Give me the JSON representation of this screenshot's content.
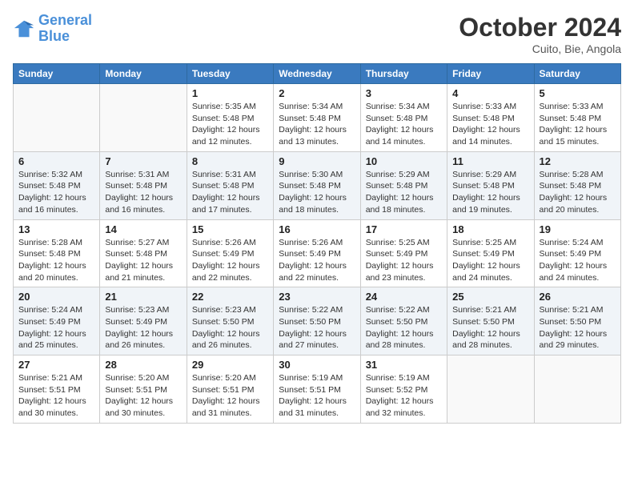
{
  "logo": {
    "line1": "General",
    "line2": "Blue"
  },
  "title": "October 2024",
  "location": "Cuito, Bie, Angola",
  "days_header": [
    "Sunday",
    "Monday",
    "Tuesday",
    "Wednesday",
    "Thursday",
    "Friday",
    "Saturday"
  ],
  "weeks": [
    [
      {
        "num": "",
        "info": ""
      },
      {
        "num": "",
        "info": ""
      },
      {
        "num": "1",
        "info": "Sunrise: 5:35 AM\nSunset: 5:48 PM\nDaylight: 12 hours\nand 12 minutes."
      },
      {
        "num": "2",
        "info": "Sunrise: 5:34 AM\nSunset: 5:48 PM\nDaylight: 12 hours\nand 13 minutes."
      },
      {
        "num": "3",
        "info": "Sunrise: 5:34 AM\nSunset: 5:48 PM\nDaylight: 12 hours\nand 14 minutes."
      },
      {
        "num": "4",
        "info": "Sunrise: 5:33 AM\nSunset: 5:48 PM\nDaylight: 12 hours\nand 14 minutes."
      },
      {
        "num": "5",
        "info": "Sunrise: 5:33 AM\nSunset: 5:48 PM\nDaylight: 12 hours\nand 15 minutes."
      }
    ],
    [
      {
        "num": "6",
        "info": "Sunrise: 5:32 AM\nSunset: 5:48 PM\nDaylight: 12 hours\nand 16 minutes."
      },
      {
        "num": "7",
        "info": "Sunrise: 5:31 AM\nSunset: 5:48 PM\nDaylight: 12 hours\nand 16 minutes."
      },
      {
        "num": "8",
        "info": "Sunrise: 5:31 AM\nSunset: 5:48 PM\nDaylight: 12 hours\nand 17 minutes."
      },
      {
        "num": "9",
        "info": "Sunrise: 5:30 AM\nSunset: 5:48 PM\nDaylight: 12 hours\nand 18 minutes."
      },
      {
        "num": "10",
        "info": "Sunrise: 5:29 AM\nSunset: 5:48 PM\nDaylight: 12 hours\nand 18 minutes."
      },
      {
        "num": "11",
        "info": "Sunrise: 5:29 AM\nSunset: 5:48 PM\nDaylight: 12 hours\nand 19 minutes."
      },
      {
        "num": "12",
        "info": "Sunrise: 5:28 AM\nSunset: 5:48 PM\nDaylight: 12 hours\nand 20 minutes."
      }
    ],
    [
      {
        "num": "13",
        "info": "Sunrise: 5:28 AM\nSunset: 5:48 PM\nDaylight: 12 hours\nand 20 minutes."
      },
      {
        "num": "14",
        "info": "Sunrise: 5:27 AM\nSunset: 5:48 PM\nDaylight: 12 hours\nand 21 minutes."
      },
      {
        "num": "15",
        "info": "Sunrise: 5:26 AM\nSunset: 5:49 PM\nDaylight: 12 hours\nand 22 minutes."
      },
      {
        "num": "16",
        "info": "Sunrise: 5:26 AM\nSunset: 5:49 PM\nDaylight: 12 hours\nand 22 minutes."
      },
      {
        "num": "17",
        "info": "Sunrise: 5:25 AM\nSunset: 5:49 PM\nDaylight: 12 hours\nand 23 minutes."
      },
      {
        "num": "18",
        "info": "Sunrise: 5:25 AM\nSunset: 5:49 PM\nDaylight: 12 hours\nand 24 minutes."
      },
      {
        "num": "19",
        "info": "Sunrise: 5:24 AM\nSunset: 5:49 PM\nDaylight: 12 hours\nand 24 minutes."
      }
    ],
    [
      {
        "num": "20",
        "info": "Sunrise: 5:24 AM\nSunset: 5:49 PM\nDaylight: 12 hours\nand 25 minutes."
      },
      {
        "num": "21",
        "info": "Sunrise: 5:23 AM\nSunset: 5:49 PM\nDaylight: 12 hours\nand 26 minutes."
      },
      {
        "num": "22",
        "info": "Sunrise: 5:23 AM\nSunset: 5:50 PM\nDaylight: 12 hours\nand 26 minutes."
      },
      {
        "num": "23",
        "info": "Sunrise: 5:22 AM\nSunset: 5:50 PM\nDaylight: 12 hours\nand 27 minutes."
      },
      {
        "num": "24",
        "info": "Sunrise: 5:22 AM\nSunset: 5:50 PM\nDaylight: 12 hours\nand 28 minutes."
      },
      {
        "num": "25",
        "info": "Sunrise: 5:21 AM\nSunset: 5:50 PM\nDaylight: 12 hours\nand 28 minutes."
      },
      {
        "num": "26",
        "info": "Sunrise: 5:21 AM\nSunset: 5:50 PM\nDaylight: 12 hours\nand 29 minutes."
      }
    ],
    [
      {
        "num": "27",
        "info": "Sunrise: 5:21 AM\nSunset: 5:51 PM\nDaylight: 12 hours\nand 30 minutes."
      },
      {
        "num": "28",
        "info": "Sunrise: 5:20 AM\nSunset: 5:51 PM\nDaylight: 12 hours\nand 30 minutes."
      },
      {
        "num": "29",
        "info": "Sunrise: 5:20 AM\nSunset: 5:51 PM\nDaylight: 12 hours\nand 31 minutes."
      },
      {
        "num": "30",
        "info": "Sunrise: 5:19 AM\nSunset: 5:51 PM\nDaylight: 12 hours\nand 31 minutes."
      },
      {
        "num": "31",
        "info": "Sunrise: 5:19 AM\nSunset: 5:52 PM\nDaylight: 12 hours\nand 32 minutes."
      },
      {
        "num": "",
        "info": ""
      },
      {
        "num": "",
        "info": ""
      }
    ]
  ]
}
